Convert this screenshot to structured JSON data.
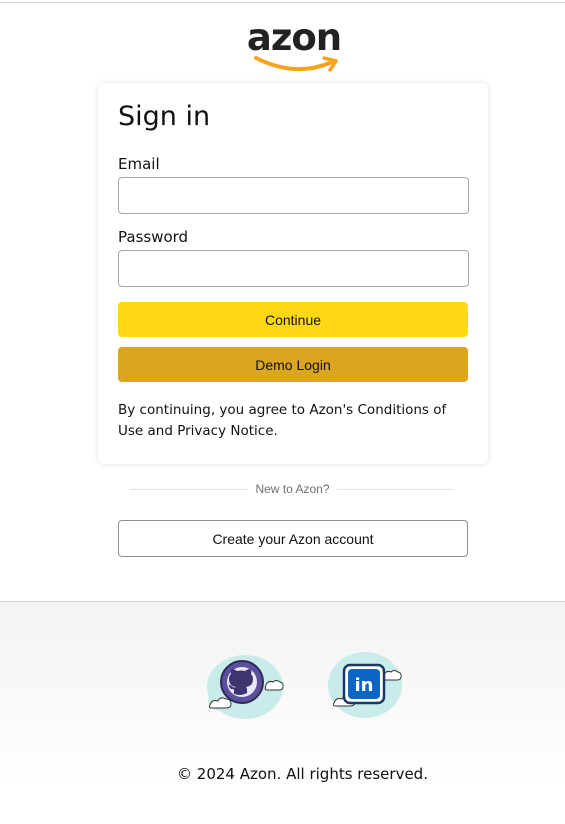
{
  "brand": {
    "logo_text": "azon",
    "logo_accent_color": "#f7a21b"
  },
  "signin": {
    "title": "Sign in",
    "email_label": "Email",
    "email_value": "",
    "password_label": "Password",
    "password_value": "",
    "continue_label": "Continue",
    "demo_label": "Demo Login",
    "terms_text": "By continuing, you agree to Azon's Conditions of Use and Privacy Notice."
  },
  "new_customer": {
    "divider_text": "New to Azon?",
    "create_account_label": "Create your Azon account"
  },
  "footer": {
    "social_icons": [
      "github-icon",
      "linkedin-icon"
    ],
    "copyright": "© 2024 Azon. All rights reserved."
  },
  "colors": {
    "continue_button": "#ffd814",
    "demo_button": "#daa520",
    "linkedin_blue": "#0a66c2",
    "github_purple": "#5b4f9e"
  }
}
